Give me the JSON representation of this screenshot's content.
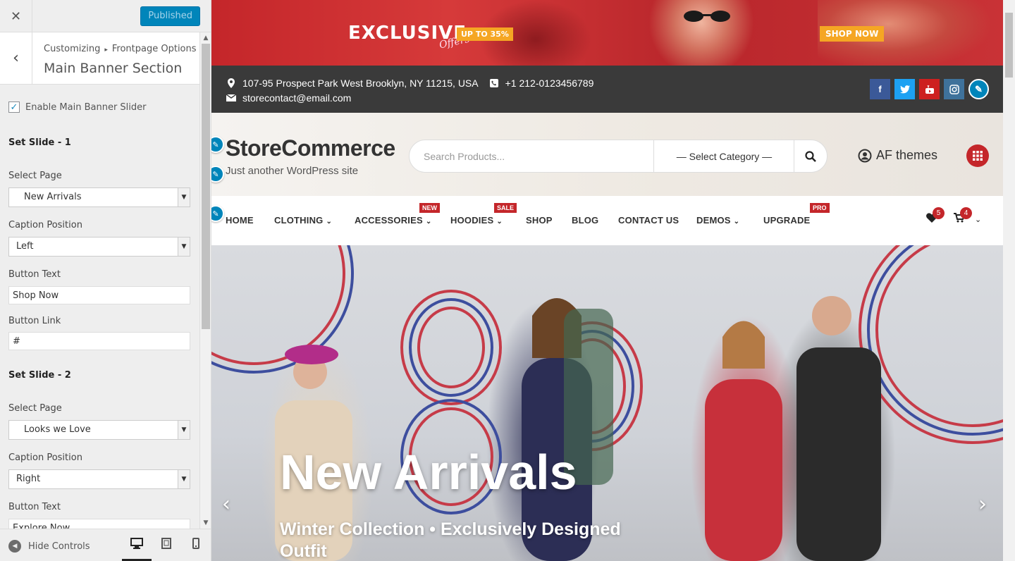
{
  "sidebar": {
    "close_icon": "close-icon",
    "publish_label": "Published",
    "breadcrumb": {
      "root": "Customizing",
      "parent": "Frontpage Options"
    },
    "section_title": "Main Banner Section",
    "enable_slider_label": "Enable Main Banner Slider",
    "enable_slider_checked": true,
    "slides": [
      {
        "heading": "Set Slide - 1",
        "select_page_label": "Select Page",
        "select_page_value": "New Arrivals",
        "caption_position_label": "Caption Position",
        "caption_position_value": "Left",
        "button_text_label": "Button Text",
        "button_text_value": "Shop Now",
        "button_link_label": "Button Link",
        "button_link_value": "#"
      },
      {
        "heading": "Set Slide - 2",
        "select_page_label": "Select Page",
        "select_page_value": "Looks we Love",
        "caption_position_label": "Caption Position",
        "caption_position_value": "Right",
        "button_text_label": "Button Text",
        "button_text_value": "Explore Now"
      }
    ],
    "footer": {
      "hide_controls_label": "Hide Controls",
      "devices": [
        "desktop-icon",
        "tablet-icon",
        "mobile-icon"
      ],
      "active_device": "desktop"
    }
  },
  "preview": {
    "ad": {
      "exclusive": "EXCLUSIVE",
      "offers": "Offers",
      "upto": "UP TO 35%",
      "shop_now": "SHOP NOW"
    },
    "topbar": {
      "address": "107-95 Prospect Park West Brooklyn, NY 11215, USA",
      "phone": "+1 212-0123456789",
      "email": "storecontact@email.com",
      "socials": [
        "facebook-icon",
        "twitter-icon",
        "youtube-icon",
        "instagram-icon"
      ]
    },
    "header": {
      "site_title": "StoreCommerce",
      "tagline": "Just another WordPress site",
      "search_placeholder": "Search Products...",
      "category_select": "— Select Category —",
      "account": "AF themes"
    },
    "nav": {
      "items": [
        {
          "label": "HOME",
          "dropdown": false
        },
        {
          "label": "CLOTHING",
          "dropdown": true
        },
        {
          "label": "ACCESSORIES",
          "dropdown": true,
          "badge": "NEW"
        },
        {
          "label": "HOODIES",
          "dropdown": true,
          "badge": "SALE"
        },
        {
          "label": "SHOP",
          "dropdown": false
        },
        {
          "label": "BLOG",
          "dropdown": false
        },
        {
          "label": "CONTACT US",
          "dropdown": false
        },
        {
          "label": "DEMOS",
          "dropdown": true
        },
        {
          "label": "UPGRADE",
          "dropdown": false,
          "badge": "PRO"
        }
      ],
      "wishlist_count": "5",
      "cart_count": "4"
    },
    "hero": {
      "title": "New Arrivals",
      "subtitle": "Winter Collection • Exclusively Designed Outfit"
    }
  },
  "colors": {
    "accent": "#c4262a",
    "wp_blue": "#0085ba",
    "topbar": "#3a3a3a"
  }
}
